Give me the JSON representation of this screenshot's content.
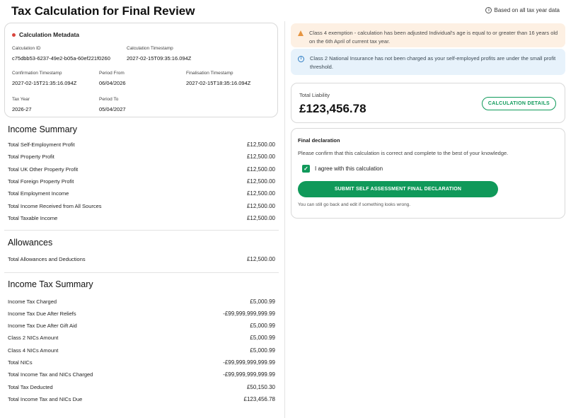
{
  "header": {
    "title": "Tax Calculation for Final Review",
    "note": "Based on all tax year data"
  },
  "metadata": {
    "heading": "Calculation Metadata",
    "calc_id_label": "Calculation ID",
    "calc_id": "c75dbb53-6237-49e2-b05a-60ef221f0260",
    "calc_ts_label": "Calculation Timestamp",
    "calc_ts": "2027-02-15T09:35:16.094Z",
    "conf_ts_label": "Confirmation Timestamp",
    "conf_ts": "2027-02-15T21:35:16.094Z",
    "period_from_label": "Period From",
    "period_from": "06/04/2026",
    "final_ts_label": "Finalisation Timestamp",
    "final_ts": "2027-02-15T18:35:16.094Z",
    "tax_year_label": "Tax Year",
    "tax_year": "2026-27",
    "period_to_label": "Period To",
    "period_to": "05/04/2027"
  },
  "income_summary": {
    "title": "Income Summary",
    "rows": [
      {
        "label": "Total Self-Employment Profit",
        "amount": "£12,500.00"
      },
      {
        "label": "Total Property Profit",
        "amount": "£12,500.00"
      },
      {
        "label": "Total UK Other Property Profit",
        "amount": "£12,500.00"
      },
      {
        "label": "Total Foreign Property Profit",
        "amount": "£12,500.00"
      },
      {
        "label": "Total Employment Income",
        "amount": "£12,500.00"
      },
      {
        "label": "Total Income Received from All Sources",
        "amount": "£12,500.00"
      },
      {
        "label": "Total Taxable Income",
        "amount": "£12,500.00"
      }
    ]
  },
  "allowances": {
    "title": "Allowances",
    "rows": [
      {
        "label": "Total Allowances and Deductions",
        "amount": "£12,500.00"
      }
    ]
  },
  "income_tax_summary": {
    "title": "Income Tax Summary",
    "rows": [
      {
        "label": "Income Tax Charged",
        "amount": "£5,000.99"
      },
      {
        "label": "Income Tax Due After Reliefs",
        "amount": "-£99,999,999,999.99"
      },
      {
        "label": "Income Tax Due After Gift Aid",
        "amount": "£5,000.99"
      },
      {
        "label": "Class 2 NICs Amount",
        "amount": "£5,000.99"
      },
      {
        "label": "Class 4 NICs Amount",
        "amount": "£5,000.99"
      },
      {
        "label": "Total NICs",
        "amount": "-£99,999,999,999.99"
      },
      {
        "label": "Total Income Tax and NICs Charged",
        "amount": "-£99,999,999,999.99"
      },
      {
        "label": "Total Tax Deducted",
        "amount": "£50,150.30"
      },
      {
        "label": "Total Income Tax and NICs Due",
        "amount": "£123,456.78"
      }
    ]
  },
  "alerts": {
    "warning": "Class 4 exemption - calculation has been adjusted Individual's age is equal to or greater than 16 years old on the 6th April of current tax year.",
    "info": "Class 2 National Insurance has not been charged as your self-employed profits are under the small profit threshold."
  },
  "liability": {
    "label": "Total Liability",
    "amount": "£123,456.78",
    "details_button": "CALCULATION DETAILS"
  },
  "declaration": {
    "title": "Final declaration",
    "text": "Please confirm that this calculation is correct and complete to the best of your knowledge.",
    "checkbox_label": "I agree with this calculation",
    "submit_button": "SUBMIT SELF ASSESSMENT FINAL DECLARATION",
    "note": "You can still go back and edit if something looks wrong."
  },
  "colors": {
    "accent_green": "#10995a",
    "warning_bg": "#fdf0e3",
    "info_bg": "#e7f2fb",
    "status_dot": "#d9453d"
  }
}
